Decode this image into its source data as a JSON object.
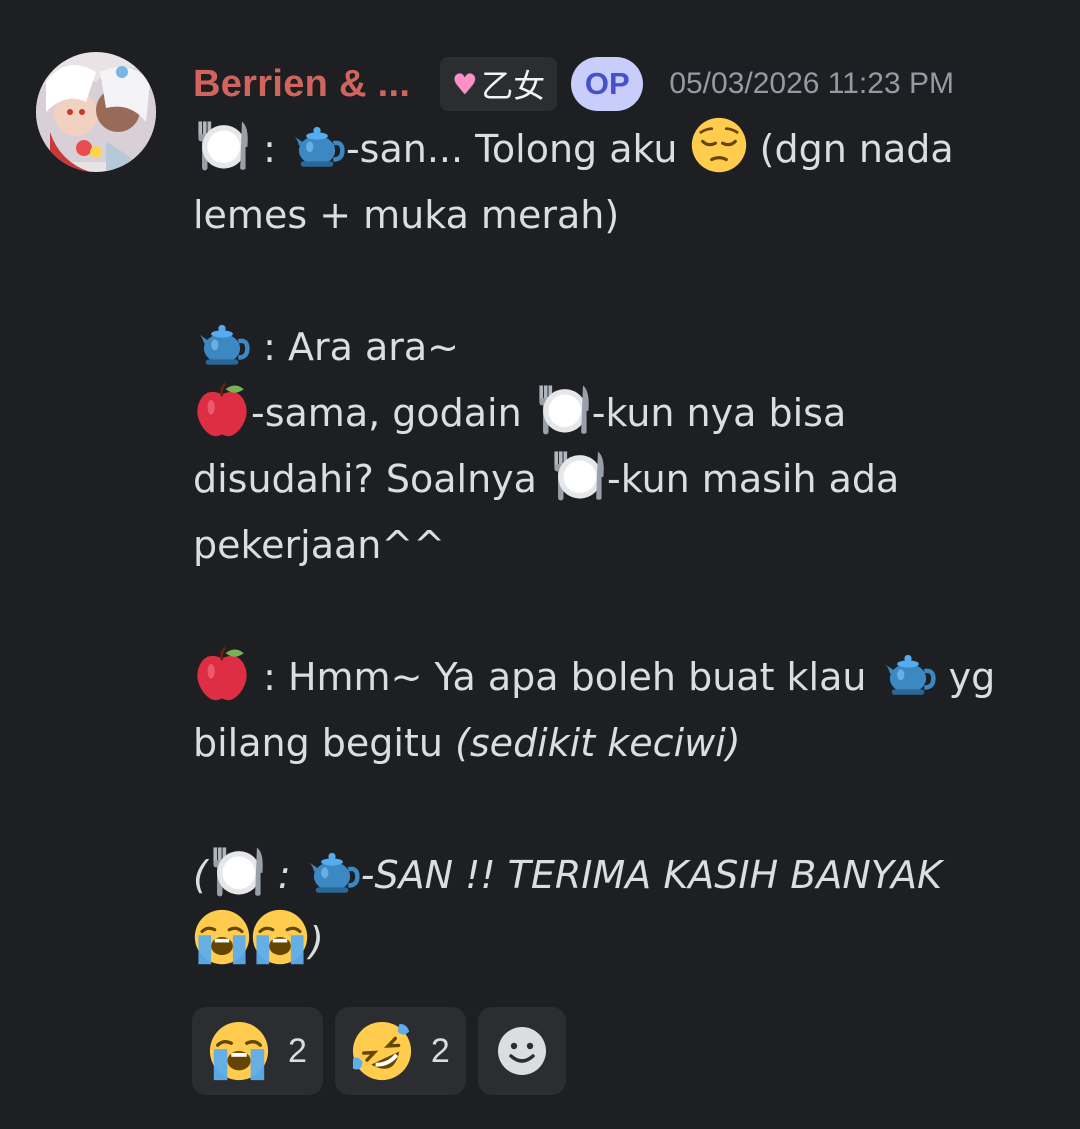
{
  "message": {
    "author": "Berrien & ...",
    "role_tag": "乙女",
    "op_badge": "OP",
    "timestamp": "05/03/2026 11:23 PM",
    "lines": {
      "l1a": " : ",
      "l1b": "-san... Tolong aku ",
      "l1c": " (dgn nada",
      "l2": "lemes + muka merah)",
      "l3": " : Ara ara~",
      "l4a": "-sama, godain ",
      "l4b": "-kun nya bisa",
      "l5a": "disudahi? Soalnya ",
      "l5b": "-kun masih ada",
      "l6": "pekerjaan^^",
      "l7a": " : Hmm~ Ya apa boleh buat klau ",
      "l7b": " yg",
      "l8a": "bilang begitu ",
      "l8b": "(sedikit keciwi)",
      "l9a": "(",
      "l9b": " : ",
      "l9c": "-SAN !! TERIMA KASIH BANYAK",
      "l10": ")"
    }
  },
  "reactions": [
    {
      "emoji": "loudly-crying-face",
      "count": "2"
    },
    {
      "emoji": "rolling-on-floor-laughing",
      "count": "2"
    }
  ],
  "colors": {
    "background": "#1e1f22",
    "username": "#d2645e",
    "op_badge_bg": "#c9cdfb",
    "op_badge_text": "#4650c8",
    "timestamp": "#949ba4",
    "text": "#dbdee1",
    "reaction_bg": "#2b2d31"
  }
}
